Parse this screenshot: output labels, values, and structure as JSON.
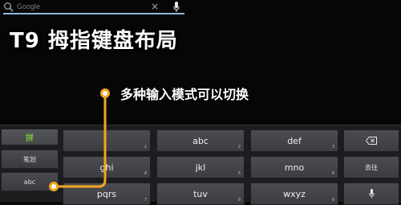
{
  "search": {
    "placeholder": "Google",
    "clear_symbol": "×"
  },
  "headline": "T9 拇指键盘布局",
  "callout": "多种输入模式可以切换",
  "keyboard": {
    "side_keys": [
      "拼",
      "笔划",
      "abc"
    ],
    "rows": [
      [
        {
          "label": "",
          "num": "1"
        },
        {
          "label": "abc",
          "num": "2"
        },
        {
          "label": "def",
          "num": "3"
        }
      ],
      [
        {
          "label": "ghi",
          "num": "4"
        },
        {
          "label": "jkl",
          "num": "5"
        },
        {
          "label": "mno",
          "num": "6"
        }
      ],
      [
        {
          "label": "pqrs",
          "num": "7"
        },
        {
          "label": "tuv",
          "num": "8"
        },
        {
          "label": "wxyz",
          "num": "9"
        }
      ]
    ],
    "clear_key_label": "去往"
  },
  "colors": {
    "accent_orange": "#f3a521",
    "search_underline": "#8fb8de",
    "pinyin_green": "#7ac143"
  },
  "icons": [
    "search-icon",
    "clear-icon",
    "mic-icon",
    "delete-icon",
    "voice-icon"
  ]
}
